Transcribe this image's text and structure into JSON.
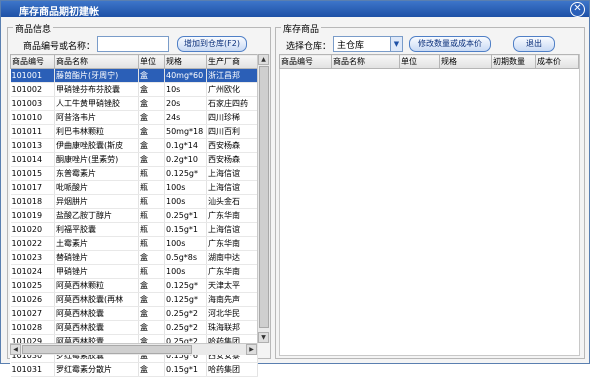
{
  "window": {
    "title": "库存商品期初建帐",
    "close_glyph": "✕"
  },
  "left": {
    "group_label": "商品信息",
    "search_label": "商品编号或名称：",
    "search_value": "",
    "add_button": "增加到仓库(F2)",
    "columns": [
      "商品编号",
      "商品名称",
      "单位",
      "规格",
      "生产厂商"
    ],
    "rows": [
      [
        "101001",
        "藤茵酯片(牙周宁)",
        "盒",
        "40mg*60",
        "浙江昌邦"
      ],
      [
        "101002",
        "甲硝锉芬布芬胶囊",
        "盒",
        "10s",
        "广州欧化"
      ],
      [
        "101003",
        "人工牛黄甲硝锉胶",
        "盒",
        "20s",
        "石家庄四药"
      ],
      [
        "101010",
        "阿昔洛韦片",
        "盒",
        "24s",
        "四川珍稀"
      ],
      [
        "101011",
        "利巴韦林颗粒",
        "盒",
        "50mg*18",
        "四川百利"
      ],
      [
        "101013",
        "伊曲康唑胶囊(斯皮",
        "盒",
        "0.1g*14",
        "西安杨森"
      ],
      [
        "101014",
        "酮康唑片(里素劳)",
        "盒",
        "0.2g*10",
        "西安杨森"
      ],
      [
        "101015",
        "东普霉素片",
        "瓶",
        "0.125g*",
        "上海信谊"
      ],
      [
        "101017",
        "吡哌酸片",
        "瓶",
        "100s",
        "上海信谊"
      ],
      [
        "101018",
        "异烟肼片",
        "瓶",
        "100s",
        "汕头金石"
      ],
      [
        "101019",
        "盐酸乙胺丁醇片",
        "瓶",
        "0.25g*1",
        "广东华南"
      ],
      [
        "101020",
        "利福平胶囊",
        "瓶",
        "0.15g*1",
        "上海信谊"
      ],
      [
        "101022",
        "土霉素片",
        "瓶",
        "100s",
        "广东华南"
      ],
      [
        "101023",
        "替硝锉片",
        "盒",
        "0.5g*8s",
        "湖南中达"
      ],
      [
        "101024",
        "甲硝锉片",
        "瓶",
        "100s",
        "广东华南"
      ],
      [
        "101025",
        "阿莫西林颗粒",
        "盒",
        "0.125g*",
        "天津太平"
      ],
      [
        "101026",
        "阿莫西林胶囊(再林",
        "盒",
        "0.125g*",
        "海南先声"
      ],
      [
        "101027",
        "阿莫西林胶囊",
        "盒",
        "0.25g*2",
        "河北华民"
      ],
      [
        "101028",
        "阿莫西林胶囊",
        "盒",
        "0.25g*2",
        "珠海联邦"
      ],
      [
        "101029",
        "阿莫西林胶囊",
        "盒",
        "0.25g*2",
        "哈药集团"
      ],
      [
        "101030",
        "罗红霉素胶囊",
        "盒",
        "0.15g*6",
        "西安安泰"
      ],
      [
        "101031",
        "罗红霉素分散片",
        "盒",
        "0.15g*1",
        "哈药集团"
      ]
    ]
  },
  "right": {
    "group_label": "库存商品",
    "warehouse_label": "选择仓库：",
    "warehouse_value": "主仓库",
    "modify_button": "修改数量或成本价",
    "exit_button": "退出",
    "columns": [
      "商品编号",
      "商品名称",
      "单位",
      "规格",
      "初期数量",
      "成本价"
    ]
  },
  "icons": {
    "scroll_up": "▲",
    "scroll_down": "▼",
    "scroll_left": "◀",
    "scroll_right": "▶",
    "dropdown": "▼"
  }
}
